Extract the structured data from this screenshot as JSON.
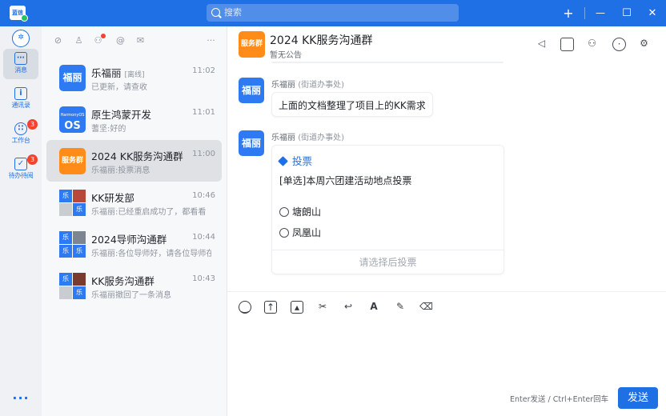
{
  "app": {
    "logo_text": "蓝信"
  },
  "search": {
    "placeholder": "搜索"
  },
  "window_controls": {
    "add": "+",
    "minimize": "—",
    "maximize": "☐",
    "close": "✕"
  },
  "rail": {
    "items": [
      {
        "label": "消息",
        "icon": "chat-icon",
        "badge": ""
      },
      {
        "label": "通讯录",
        "icon": "contacts-icon",
        "badge": ""
      },
      {
        "label": "工作台",
        "icon": "workbench-icon",
        "badge": "3"
      },
      {
        "label": "待办待阅",
        "icon": "todo-icon",
        "badge": "3"
      }
    ],
    "more": "···"
  },
  "conversations": [
    {
      "title": "乐福丽",
      "tag": "[离线]",
      "time": "11:02",
      "preview": "已更新，请查收",
      "avatar_text": "福丽"
    },
    {
      "title": "原生鸿蒙开发",
      "tag": "",
      "time": "11:01",
      "preview": "蓍坚:好的",
      "avatar_text": "OS",
      "avatar_sub": "HarmonyOS"
    },
    {
      "title": "2024 KK服务沟通群",
      "tag": "",
      "time": "11:00",
      "preview": "乐福丽:投票消息",
      "avatar_text": "服务群"
    },
    {
      "title": "KK研发部",
      "tag": "",
      "time": "10:46",
      "preview": "乐福丽:已经重启成功了，都看看",
      "avatar_text": "乐"
    },
    {
      "title": "2024导师沟通群",
      "tag": "",
      "time": "10:44",
      "preview": "乐福丽:各位导师好，请各位导师在…",
      "avatar_text": "乐"
    },
    {
      "title": "KK服务沟通群",
      "tag": "",
      "time": "10:43",
      "preview": "乐福丽撤回了一条消息",
      "avatar_text": "乐"
    }
  ],
  "chat": {
    "avatar_text": "服务群",
    "title": "2024 KK服务沟通群",
    "notice": "暂无公告",
    "messages": [
      {
        "avatar_text": "福丽",
        "sender": "乐福丽",
        "dept": "(街道办事处)",
        "text": "上面的文档整理了项目上的KK需求"
      },
      {
        "avatar_text": "福丽",
        "sender": "乐福丽",
        "dept": "(街道办事处)"
      }
    ],
    "vote": {
      "heading": "投票",
      "question": "[单选]本周六团建活动地点投票",
      "options": [
        "塘朗山",
        "凤凰山"
      ],
      "footer": "请选择后投票"
    }
  },
  "composer": {
    "hint": "Enter发送 / Ctrl+Enter回车",
    "send_label": "发送"
  },
  "colors": {
    "accent": "#1f6fe5",
    "orange": "#ff8c19",
    "badge": "#f5422c"
  }
}
